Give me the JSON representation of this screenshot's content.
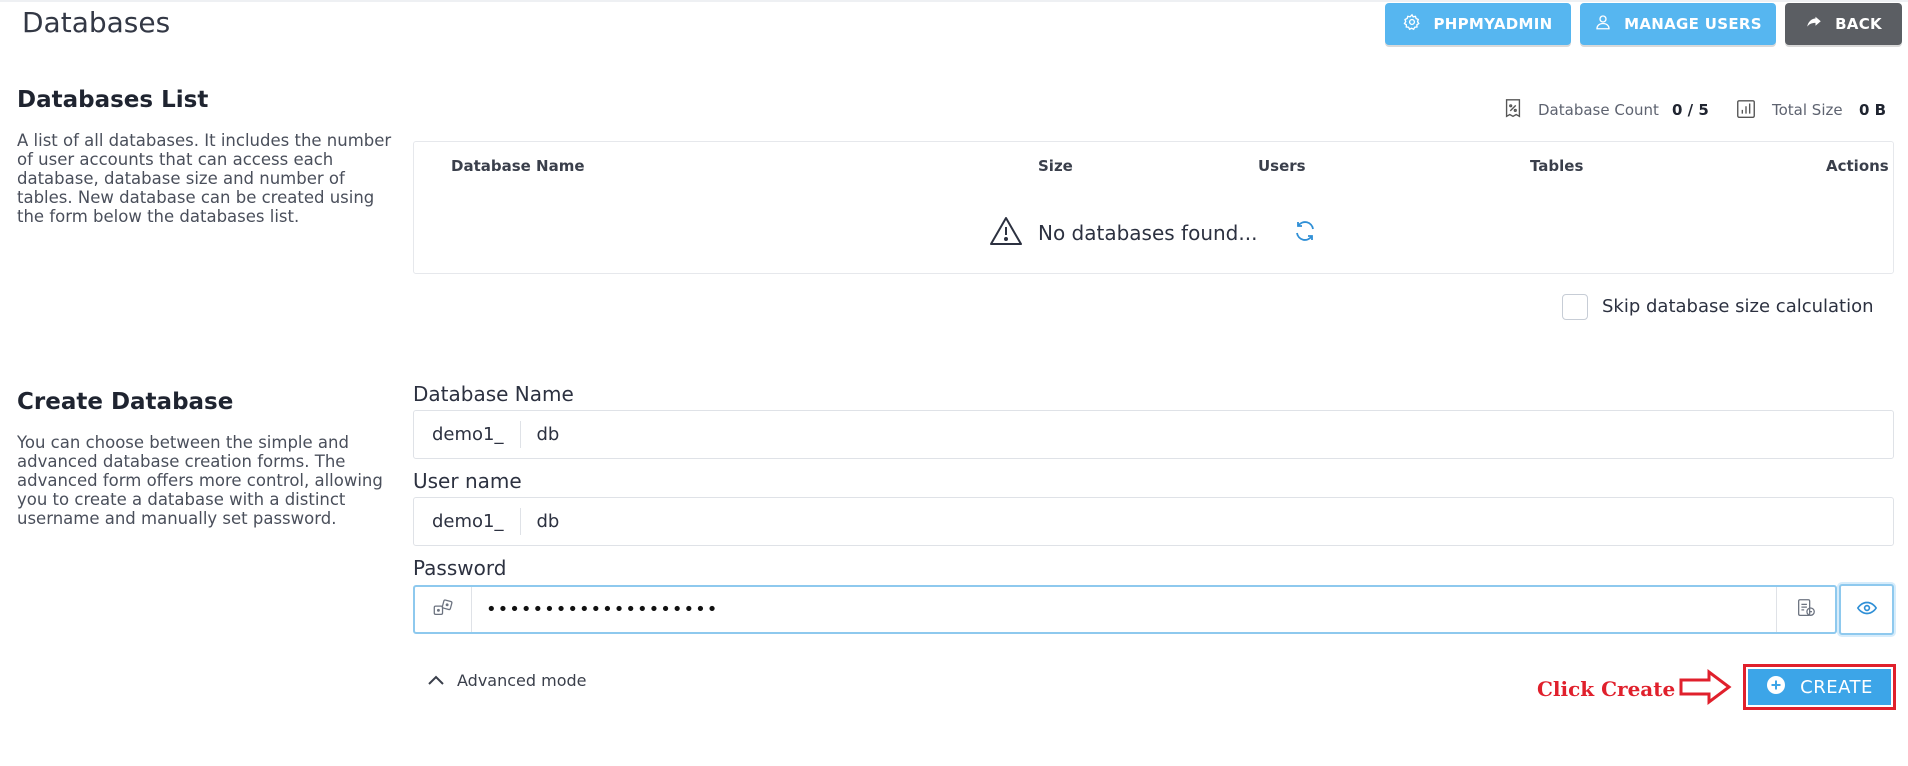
{
  "header": {
    "title": "Databases",
    "phpmyadmin_label": "PHPMYADMIN",
    "manage_users_label": "MANAGE USERS",
    "back_label": "BACK"
  },
  "databases_list": {
    "title": "Databases List",
    "description": "A list of all databases. It includes the number of user accounts that can access each database, database size and number of tables. New database can be created using the form below the databases list.",
    "stats": {
      "count_label": "Database Count",
      "count_value": "0 / 5",
      "size_label": "Total Size",
      "size_value": "0 B"
    },
    "columns": [
      "Database Name",
      "Size",
      "Users",
      "Tables",
      "Actions"
    ],
    "empty_message": "No databases found...",
    "skip_size_label": "Skip database size calculation",
    "skip_size_checked": false
  },
  "create_database": {
    "title": "Create Database",
    "description": "You can choose between the simple and advanced database creation forms. The advanced form offers more control, allowing you to create a database with a distinct username and manually set password.",
    "db_name": {
      "label": "Database Name",
      "prefix": "demo1_",
      "value": "db"
    },
    "user_name": {
      "label": "User name",
      "prefix": "demo1_",
      "value": "db"
    },
    "password": {
      "label": "Password",
      "value": "••••••••••••••••••••"
    },
    "advanced_label": "Advanced mode",
    "create_label": "CREATE"
  },
  "annotation": {
    "text": "Click Create",
    "color": "#e0202c"
  },
  "colors": {
    "accent": "#56b6f0",
    "create": "#3ca5e8",
    "back": "#5b5e63"
  }
}
